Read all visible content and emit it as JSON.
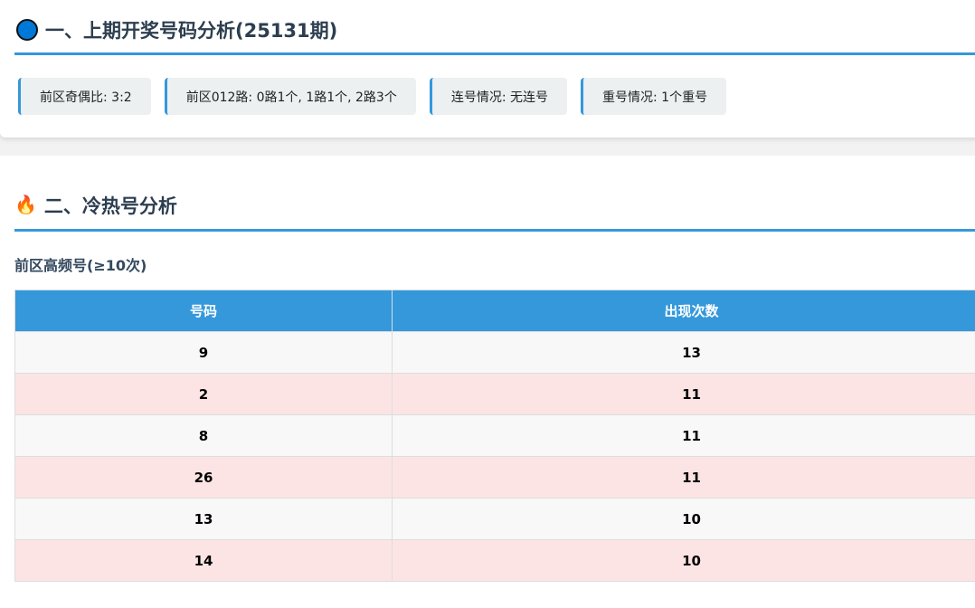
{
  "section1": {
    "title": "一、上期开奖号码分析(25131期)",
    "icon": "blue-circle",
    "stats": [
      "前区奇偶比: 3:2",
      "前区012路: 0路1个, 1路1个, 2路3个",
      "连号情况: 无连号",
      "重号情况: 1个重号"
    ]
  },
  "section2": {
    "title": "二、冷热号分析",
    "icon": "fire",
    "subtitle": "前区高频号(≥10次)",
    "headers": [
      "号码",
      "出现次数"
    ],
    "rows": [
      [
        "9",
        "13"
      ],
      [
        "2",
        "11"
      ],
      [
        "8",
        "11"
      ],
      [
        "26",
        "11"
      ],
      [
        "13",
        "10"
      ],
      [
        "14",
        "10"
      ]
    ]
  }
}
